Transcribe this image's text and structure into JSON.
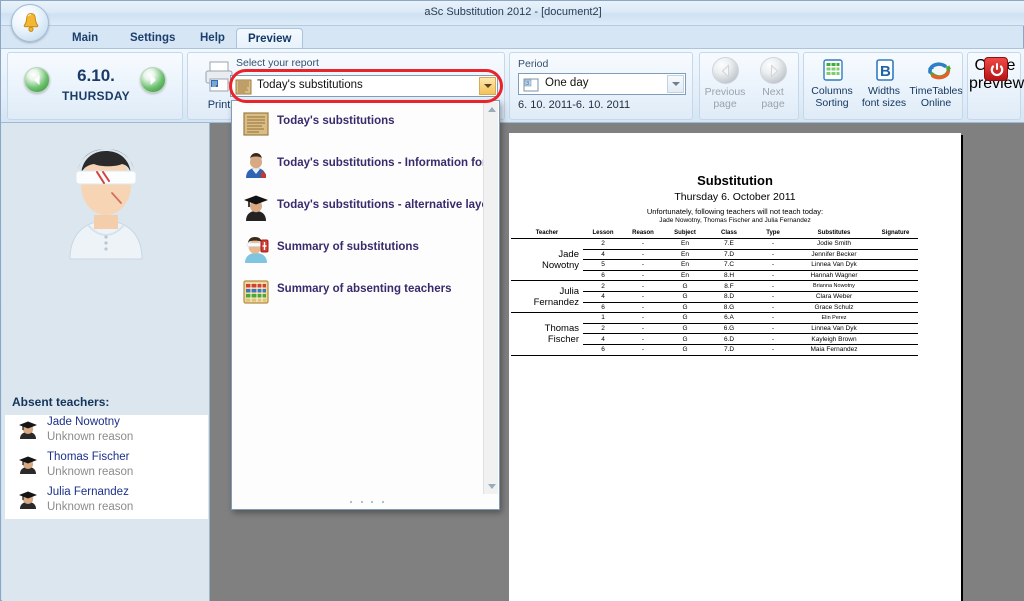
{
  "window": {
    "title": "aSc Substitution 2012  - [document2]",
    "logo_icon": "bell-icon"
  },
  "tabs": [
    {
      "label": "Main",
      "active": false
    },
    {
      "label": "Settings",
      "active": false
    },
    {
      "label": "Help",
      "active": false
    },
    {
      "label": "Preview",
      "active": true
    }
  ],
  "ribbon": {
    "date_nav": {
      "prev_icon": "arrow-left-icon",
      "next_icon": "arrow-right-icon",
      "date": "6.10.",
      "weekday": "THURSDAY"
    },
    "report_group": {
      "caption": "Select your report",
      "print_label": "Print",
      "print_icon": "printer-icon",
      "selected_report": "Today's substitutions",
      "combo_icon": "scroll-report-icon",
      "dropdown_arrow_icon": "chevron-down-icon"
    },
    "period_group": {
      "caption": "Period",
      "selected": "One day",
      "icon": "calendar-icon",
      "range": "6. 10. 2011-6. 10. 2011",
      "dropdown_arrow_icon": "chevron-down-icon"
    },
    "pages_group": {
      "previous": {
        "line1": "Previous",
        "line2": "page",
        "icon": "arrow-left-circle-icon"
      },
      "next": {
        "line1": "Next",
        "line2": "page",
        "icon": "arrow-right-circle-icon"
      }
    },
    "tools_group": [
      {
        "line1": "Columns",
        "line2": "Sorting",
        "icon": "table-columns-icon"
      },
      {
        "line1": "Widths",
        "line2": "font sizes",
        "icon": "bold-b-icon"
      },
      {
        "line1": "TimeTables",
        "line2": "Online",
        "icon": "sync-arrows-icon"
      }
    ],
    "close_group": {
      "line1": "Close",
      "line2": "preview",
      "icon": "power-icon"
    }
  },
  "dropdown": {
    "open": true,
    "items": [
      {
        "label": "Today's substitutions",
        "icon": "scroll-report-icon"
      },
      {
        "label": "Today's substitutions - Information for st",
        "icon": "student-icon"
      },
      {
        "label": "Today's substitutions - alternative layout",
        "icon": "graduate-icon"
      },
      {
        "label": "Summary of substitutions",
        "icon": "injured-teacher-icon"
      },
      {
        "label": "Summary of absenting teachers",
        "icon": "abacus-icon"
      }
    ],
    "scroll_up_icon": "scroll-up-arrow-icon",
    "scroll_down_icon": "scroll-down-arrow-icon",
    "resize_grip_icon": "resize-grip-icon"
  },
  "sidebar": {
    "hero_icon": "injured-teacher-large-icon",
    "absent_title": "Absent teachers:",
    "teachers": [
      {
        "name": "Jade Nowotny",
        "reason": "Unknown reason",
        "icon": "graduate-icon"
      },
      {
        "name": "Thomas Fischer",
        "reason": "Unknown reason",
        "icon": "graduate-icon"
      },
      {
        "name": "Julia Fernandez",
        "reason": "Unknown reason",
        "icon": "graduate-icon"
      }
    ]
  },
  "report": {
    "title": "Substitution",
    "subtitle": "Thursday 6. October 2011",
    "note": "Unfortunately, following teachers will not teach today:",
    "note_names": "Jade Nowotny, Thomas Fischer and Julia Fernandez",
    "columns": [
      "Teacher",
      "Lesson",
      "Reason",
      "Subject",
      "Class",
      "Type",
      "Substitutes",
      "Signature"
    ],
    "groups": [
      {
        "teacher": "Jade\nNowotny",
        "rows": [
          {
            "lesson": "2",
            "reason": "-",
            "subject": "En",
            "class": "7.E",
            "type": "-",
            "substitute": "Jodie Smith",
            "signature": ""
          },
          {
            "lesson": "4",
            "reason": "-",
            "subject": "En",
            "class": "7.D",
            "type": "-",
            "substitute": "Jennifer Becker",
            "signature": ""
          },
          {
            "lesson": "5",
            "reason": "-",
            "subject": "En",
            "class": "7.C",
            "type": "-",
            "substitute": "Linnea Van Dyk",
            "signature": ""
          },
          {
            "lesson": "6",
            "reason": "-",
            "subject": "En",
            "class": "8.H",
            "type": "-",
            "substitute": "Hannah Wagner",
            "signature": ""
          }
        ]
      },
      {
        "teacher": "Julia\nFernandez",
        "rows": [
          {
            "lesson": "2",
            "reason": "-",
            "subject": "G",
            "class": "8.F",
            "type": "-",
            "substitute": "Brianna Nowotny",
            "signature": ""
          },
          {
            "lesson": "4",
            "reason": "-",
            "subject": "G",
            "class": "8.D",
            "type": "-",
            "substitute": "Clara Weber",
            "signature": ""
          },
          {
            "lesson": "6",
            "reason": "-",
            "subject": "G",
            "class": "8.G",
            "type": "-",
            "substitute": "Grace Schulz",
            "signature": ""
          }
        ]
      },
      {
        "teacher": "Thomas\nFischer",
        "rows": [
          {
            "lesson": "1",
            "reason": "-",
            "subject": "G",
            "class": "6.A",
            "type": "-",
            "substitute": "Elin Perez",
            "signature": ""
          },
          {
            "lesson": "2",
            "reason": "-",
            "subject": "G",
            "class": "6.G",
            "type": "-",
            "substitute": "Linnea Van Dyk",
            "signature": ""
          },
          {
            "lesson": "4",
            "reason": "-",
            "subject": "G",
            "class": "6.D",
            "type": "-",
            "substitute": "Kayleigh Brown",
            "signature": ""
          },
          {
            "lesson": "6",
            "reason": "-",
            "subject": "G",
            "class": "7.D",
            "type": "-",
            "substitute": "Maia Fernandez",
            "signature": ""
          }
        ]
      }
    ]
  },
  "colors": {
    "accent_red": "#e8252a",
    "preview_bg": "#808080",
    "sidebar_bg": "#dbe6ef",
    "ribbon_text": "#12365f",
    "dropdown_text": "#3a2a6b"
  }
}
